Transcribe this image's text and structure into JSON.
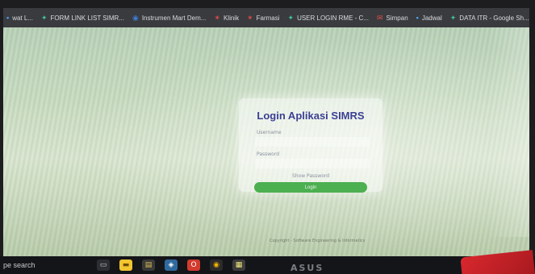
{
  "bookmarks": [
    {
      "icon": "bookmark-icon",
      "label": "wat L..."
    },
    {
      "icon": "star-bookmark-icon",
      "label": "FORM LINK LIST SIMR..."
    },
    {
      "icon": "globe-icon",
      "label": "Instrumen Mart Dem..."
    },
    {
      "icon": "red-bookmark-icon",
      "label": "Klinik"
    },
    {
      "icon": "red-bookmark-icon",
      "label": "Farmasi"
    },
    {
      "icon": "star-bookmark-icon",
      "label": "USER LOGIN RME - C..."
    },
    {
      "icon": "mail-icon",
      "label": "Simpan"
    },
    {
      "icon": "bookmark-icon",
      "label": "Jadwal"
    },
    {
      "icon": "star-bookmark-icon",
      "label": "DATA ITR - Google Sh..."
    }
  ],
  "login": {
    "title": "Login Aplikasi SIMRS",
    "username_label": "Username",
    "password_label": "Password",
    "show_password": "Show Password",
    "button": "Login"
  },
  "footer": "Copyright - Software Engineering & Informatics",
  "taskbar": {
    "search": "pe search"
  },
  "brand": "ASUS",
  "colors": {
    "title": "#3b3f93",
    "button": "#4caf50",
    "bookmarks_bar": "#3a3b3e"
  }
}
